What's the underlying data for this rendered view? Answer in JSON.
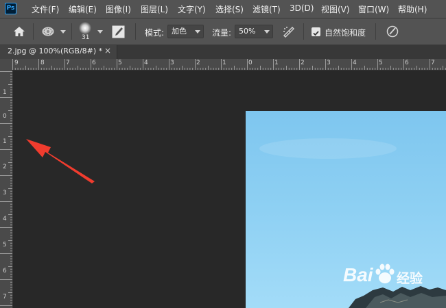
{
  "app": {
    "logo": "Ps"
  },
  "menu": [
    "文件(F)",
    "编辑(E)",
    "图像(I)",
    "图层(L)",
    "文字(Y)",
    "选择(S)",
    "滤镜(T)",
    "3D(D)",
    "视图(V)",
    "窗口(W)",
    "帮助(H)"
  ],
  "options": {
    "brush_size": "31",
    "mode_label": "模式:",
    "mode_value": "加色",
    "flow_label": "流量:",
    "flow_value": "50%",
    "saturation_label": "自然饱和度",
    "saturation_checked": true
  },
  "document": {
    "tab_title": "2.jpg @ 100%(RGB/8#) *",
    "close_icon": "×"
  },
  "ruler_top": [
    "9",
    "8",
    "7",
    "6",
    "5",
    "4",
    "3",
    "2",
    "1",
    "0",
    "1",
    "2",
    "3",
    "4",
    "5",
    "6",
    "7"
  ],
  "ruler_left": [
    "1",
    "0",
    "1",
    "2",
    "3",
    "4",
    "5",
    "6",
    "7"
  ],
  "watermark": {
    "brand": "Bai",
    "brand2": "经验"
  },
  "colors": {
    "accent": "#31a8ff",
    "arrow": "#f03c2e",
    "sky": "#8ed0f3"
  },
  "icons": [
    "home-icon",
    "brush-preset-icon",
    "brush-tip-icon",
    "brush-panel-icon",
    "airbrush-icon",
    "pressure-icon"
  ]
}
